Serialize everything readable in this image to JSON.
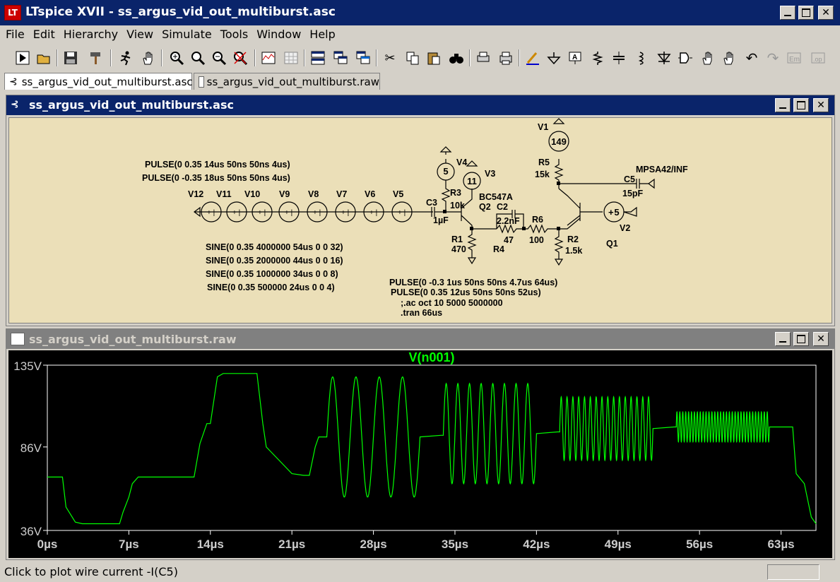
{
  "app": {
    "title": "LTspice XVII - ss_argus_vid_out_multiburst.asc"
  },
  "menu": [
    "File",
    "Edit",
    "Hierarchy",
    "View",
    "Simulate",
    "Tools",
    "Window",
    "Help"
  ],
  "tabs": [
    {
      "label": "ss_argus_vid_out_multiburst.asc"
    },
    {
      "label": "ss_argus_vid_out_multiburst.raw"
    }
  ],
  "schematic_window": {
    "title": "ss_argus_vid_out_multiburst.asc"
  },
  "plot_window": {
    "title": "ss_argus_vid_out_multiburst.raw"
  },
  "schematic": {
    "pulse_lines": [
      "PULSE(0 0.35 14us 50ns 50ns 4us)",
      "PULSE(0 -0.35 18us 50ns 50ns 4us)"
    ],
    "sine_lines": [
      "SINE(0 0.35 4000000 54us 0 0 32)",
      "SINE(0 0.35 2000000 44us 0 0 16)",
      "SINE(0 0.35 1000000 34us 0 0 8)",
      "SINE(0 0.35 500000 24us 0 0 4)"
    ],
    "pulse2_lines": [
      "PULSE(0 -0.3 1us 50ns 50ns 4.7us 64us)",
      "PULSE(0 0.35 12us 50ns 50ns 52us)",
      ";.ac oct 10 5000 5000000",
      ".tran 66us"
    ],
    "sources": [
      "V12",
      "V11",
      "V10",
      "V9",
      "V8",
      "V7",
      "V6",
      "V5"
    ],
    "labels": {
      "v1": "V1",
      "v1_val": "149",
      "r5": "R5",
      "r5_val": "15k",
      "c5": "C5",
      "c5_val": "15pF",
      "q_model": "MPSA42/INF",
      "v4": "V4",
      "v4_val": "5",
      "v3": "V3",
      "v3_val": "11",
      "r3": "R3",
      "r3_val": "10k",
      "q2_model": "BC547A",
      "q2": "Q2",
      "c2": "C2",
      "c2_val": "2.2nF",
      "c3": "C3",
      "c3_val": "1µF",
      "r6": "R6",
      "r6_val": "100",
      "r4_val": "47",
      "r4": "R4",
      "r1": "R1",
      "r1_val": "470",
      "r2": "R2",
      "r2_val": "1.5k",
      "q1": "Q1",
      "v2": "V2",
      "v2_val": "5"
    }
  },
  "chart_data": {
    "type": "line",
    "title": "V(n001)",
    "xlabel": "",
    "ylabel": "",
    "x_ticks": [
      "0µs",
      "7µs",
      "14µs",
      "21µs",
      "28µs",
      "35µs",
      "42µs",
      "49µs",
      "56µs",
      "63µs"
    ],
    "y_ticks": [
      "135V",
      "86V",
      "36V"
    ],
    "xlim": [
      0,
      66
    ],
    "ylim": [
      36,
      135
    ],
    "series": [
      {
        "color": "#00ff00",
        "segments": [
          {
            "kind": "poly",
            "points": [
              [
                0,
                68
              ],
              [
                1.3,
                68
              ],
              [
                1.6,
                50
              ],
              [
                2.4,
                41
              ],
              [
                3,
                40
              ],
              [
                6,
                40
              ]
            ]
          },
          {
            "kind": "poly",
            "points": [
              [
                6.2,
                40
              ],
              [
                6.5,
                47
              ],
              [
                7,
                56
              ],
              [
                7.3,
                64
              ],
              [
                7.8,
                68
              ],
              [
                12.5,
                68
              ]
            ]
          },
          {
            "kind": "poly",
            "points": [
              [
                12.6,
                68
              ],
              [
                13.1,
                88
              ],
              [
                13.7,
                100
              ],
              [
                14,
                100
              ]
            ]
          },
          {
            "kind": "poly",
            "points": [
              [
                14,
                100
              ],
              [
                14.6,
                128
              ],
              [
                15.1,
                130
              ],
              [
                18,
                130
              ]
            ]
          },
          {
            "kind": "poly",
            "points": [
              [
                18,
                130
              ],
              [
                18.5,
                100
              ],
              [
                18.8,
                86
              ],
              [
                21,
                70
              ],
              [
                22,
                69
              ],
              [
                22.5,
                69
              ]
            ]
          },
          {
            "kind": "poly",
            "points": [
              [
                22.5,
                69
              ],
              [
                23,
                86
              ],
              [
                23.3,
                92
              ],
              [
                24,
                92
              ]
            ]
          },
          {
            "kind": "sine",
            "t0": 24,
            "t1": 32,
            "freq": 0.5,
            "amp": 36,
            "center": 92
          },
          {
            "kind": "poly",
            "points": [
              [
                32,
                92
              ],
              [
                33.8,
                93
              ],
              [
                34,
                93
              ]
            ]
          },
          {
            "kind": "sine",
            "t0": 34,
            "t1": 42,
            "freq": 1,
            "amp": 30,
            "center": 94
          },
          {
            "kind": "poly",
            "points": [
              [
                42,
                94
              ],
              [
                43.8,
                95
              ],
              [
                44,
                95
              ]
            ]
          },
          {
            "kind": "sine",
            "t0": 44,
            "t1": 52,
            "freq": 2,
            "amp": 19,
            "center": 97
          },
          {
            "kind": "poly",
            "points": [
              [
                52,
                97
              ],
              [
                53.8,
                98
              ],
              [
                54,
                98
              ]
            ]
          },
          {
            "kind": "sine",
            "t0": 54,
            "t1": 62,
            "freq": 4,
            "amp": 9,
            "center": 98
          },
          {
            "kind": "poly",
            "points": [
              [
                62,
                98
              ],
              [
                63.7,
                98
              ],
              [
                64,
                98
              ],
              [
                64.3,
                70
              ],
              [
                65,
                64
              ],
              [
                65.6,
                44
              ],
              [
                66,
                40
              ]
            ]
          }
        ]
      }
    ]
  },
  "status": {
    "text": "Click to plot wire current -I(C5)"
  }
}
